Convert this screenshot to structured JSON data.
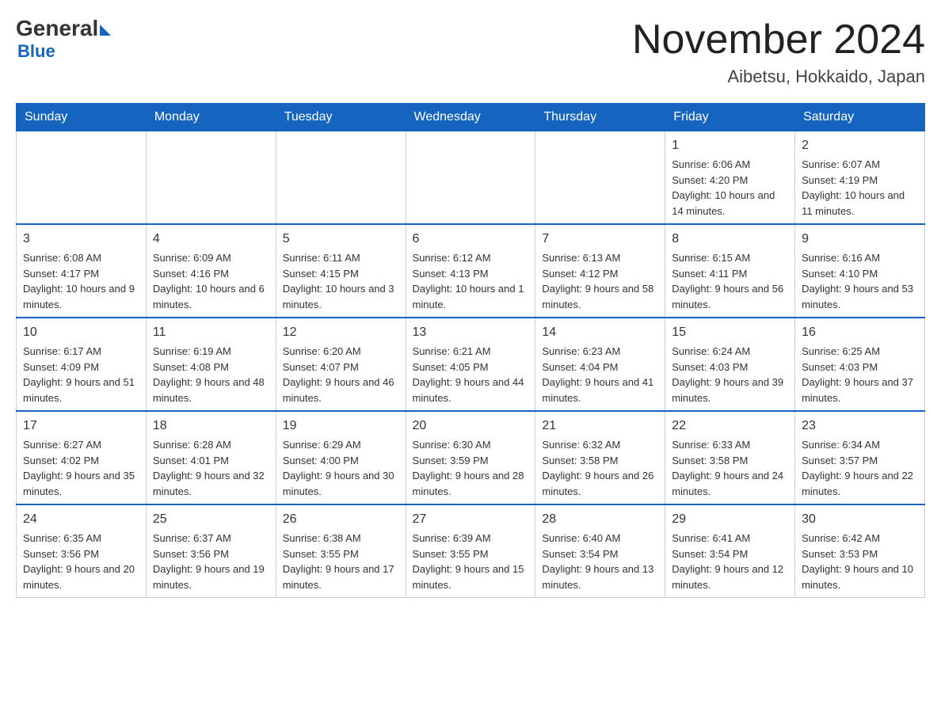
{
  "header": {
    "logo_general": "General",
    "logo_blue": "Blue",
    "month_title": "November 2024",
    "location": "Aibetsu, Hokkaido, Japan"
  },
  "weekdays": [
    "Sunday",
    "Monday",
    "Tuesday",
    "Wednesday",
    "Thursday",
    "Friday",
    "Saturday"
  ],
  "weeks": [
    [
      {
        "day": "",
        "sunrise": "",
        "sunset": "",
        "daylight": ""
      },
      {
        "day": "",
        "sunrise": "",
        "sunset": "",
        "daylight": ""
      },
      {
        "day": "",
        "sunrise": "",
        "sunset": "",
        "daylight": ""
      },
      {
        "day": "",
        "sunrise": "",
        "sunset": "",
        "daylight": ""
      },
      {
        "day": "",
        "sunrise": "",
        "sunset": "",
        "daylight": ""
      },
      {
        "day": "1",
        "sunrise": "Sunrise: 6:06 AM",
        "sunset": "Sunset: 4:20 PM",
        "daylight": "Daylight: 10 hours and 14 minutes."
      },
      {
        "day": "2",
        "sunrise": "Sunrise: 6:07 AM",
        "sunset": "Sunset: 4:19 PM",
        "daylight": "Daylight: 10 hours and 11 minutes."
      }
    ],
    [
      {
        "day": "3",
        "sunrise": "Sunrise: 6:08 AM",
        "sunset": "Sunset: 4:17 PM",
        "daylight": "Daylight: 10 hours and 9 minutes."
      },
      {
        "day": "4",
        "sunrise": "Sunrise: 6:09 AM",
        "sunset": "Sunset: 4:16 PM",
        "daylight": "Daylight: 10 hours and 6 minutes."
      },
      {
        "day": "5",
        "sunrise": "Sunrise: 6:11 AM",
        "sunset": "Sunset: 4:15 PM",
        "daylight": "Daylight: 10 hours and 3 minutes."
      },
      {
        "day": "6",
        "sunrise": "Sunrise: 6:12 AM",
        "sunset": "Sunset: 4:13 PM",
        "daylight": "Daylight: 10 hours and 1 minute."
      },
      {
        "day": "7",
        "sunrise": "Sunrise: 6:13 AM",
        "sunset": "Sunset: 4:12 PM",
        "daylight": "Daylight: 9 hours and 58 minutes."
      },
      {
        "day": "8",
        "sunrise": "Sunrise: 6:15 AM",
        "sunset": "Sunset: 4:11 PM",
        "daylight": "Daylight: 9 hours and 56 minutes."
      },
      {
        "day": "9",
        "sunrise": "Sunrise: 6:16 AM",
        "sunset": "Sunset: 4:10 PM",
        "daylight": "Daylight: 9 hours and 53 minutes."
      }
    ],
    [
      {
        "day": "10",
        "sunrise": "Sunrise: 6:17 AM",
        "sunset": "Sunset: 4:09 PM",
        "daylight": "Daylight: 9 hours and 51 minutes."
      },
      {
        "day": "11",
        "sunrise": "Sunrise: 6:19 AM",
        "sunset": "Sunset: 4:08 PM",
        "daylight": "Daylight: 9 hours and 48 minutes."
      },
      {
        "day": "12",
        "sunrise": "Sunrise: 6:20 AM",
        "sunset": "Sunset: 4:07 PM",
        "daylight": "Daylight: 9 hours and 46 minutes."
      },
      {
        "day": "13",
        "sunrise": "Sunrise: 6:21 AM",
        "sunset": "Sunset: 4:05 PM",
        "daylight": "Daylight: 9 hours and 44 minutes."
      },
      {
        "day": "14",
        "sunrise": "Sunrise: 6:23 AM",
        "sunset": "Sunset: 4:04 PM",
        "daylight": "Daylight: 9 hours and 41 minutes."
      },
      {
        "day": "15",
        "sunrise": "Sunrise: 6:24 AM",
        "sunset": "Sunset: 4:03 PM",
        "daylight": "Daylight: 9 hours and 39 minutes."
      },
      {
        "day": "16",
        "sunrise": "Sunrise: 6:25 AM",
        "sunset": "Sunset: 4:03 PM",
        "daylight": "Daylight: 9 hours and 37 minutes."
      }
    ],
    [
      {
        "day": "17",
        "sunrise": "Sunrise: 6:27 AM",
        "sunset": "Sunset: 4:02 PM",
        "daylight": "Daylight: 9 hours and 35 minutes."
      },
      {
        "day": "18",
        "sunrise": "Sunrise: 6:28 AM",
        "sunset": "Sunset: 4:01 PM",
        "daylight": "Daylight: 9 hours and 32 minutes."
      },
      {
        "day": "19",
        "sunrise": "Sunrise: 6:29 AM",
        "sunset": "Sunset: 4:00 PM",
        "daylight": "Daylight: 9 hours and 30 minutes."
      },
      {
        "day": "20",
        "sunrise": "Sunrise: 6:30 AM",
        "sunset": "Sunset: 3:59 PM",
        "daylight": "Daylight: 9 hours and 28 minutes."
      },
      {
        "day": "21",
        "sunrise": "Sunrise: 6:32 AM",
        "sunset": "Sunset: 3:58 PM",
        "daylight": "Daylight: 9 hours and 26 minutes."
      },
      {
        "day": "22",
        "sunrise": "Sunrise: 6:33 AM",
        "sunset": "Sunset: 3:58 PM",
        "daylight": "Daylight: 9 hours and 24 minutes."
      },
      {
        "day": "23",
        "sunrise": "Sunrise: 6:34 AM",
        "sunset": "Sunset: 3:57 PM",
        "daylight": "Daylight: 9 hours and 22 minutes."
      }
    ],
    [
      {
        "day": "24",
        "sunrise": "Sunrise: 6:35 AM",
        "sunset": "Sunset: 3:56 PM",
        "daylight": "Daylight: 9 hours and 20 minutes."
      },
      {
        "day": "25",
        "sunrise": "Sunrise: 6:37 AM",
        "sunset": "Sunset: 3:56 PM",
        "daylight": "Daylight: 9 hours and 19 minutes."
      },
      {
        "day": "26",
        "sunrise": "Sunrise: 6:38 AM",
        "sunset": "Sunset: 3:55 PM",
        "daylight": "Daylight: 9 hours and 17 minutes."
      },
      {
        "day": "27",
        "sunrise": "Sunrise: 6:39 AM",
        "sunset": "Sunset: 3:55 PM",
        "daylight": "Daylight: 9 hours and 15 minutes."
      },
      {
        "day": "28",
        "sunrise": "Sunrise: 6:40 AM",
        "sunset": "Sunset: 3:54 PM",
        "daylight": "Daylight: 9 hours and 13 minutes."
      },
      {
        "day": "29",
        "sunrise": "Sunrise: 6:41 AM",
        "sunset": "Sunset: 3:54 PM",
        "daylight": "Daylight: 9 hours and 12 minutes."
      },
      {
        "day": "30",
        "sunrise": "Sunrise: 6:42 AM",
        "sunset": "Sunset: 3:53 PM",
        "daylight": "Daylight: 9 hours and 10 minutes."
      }
    ]
  ]
}
